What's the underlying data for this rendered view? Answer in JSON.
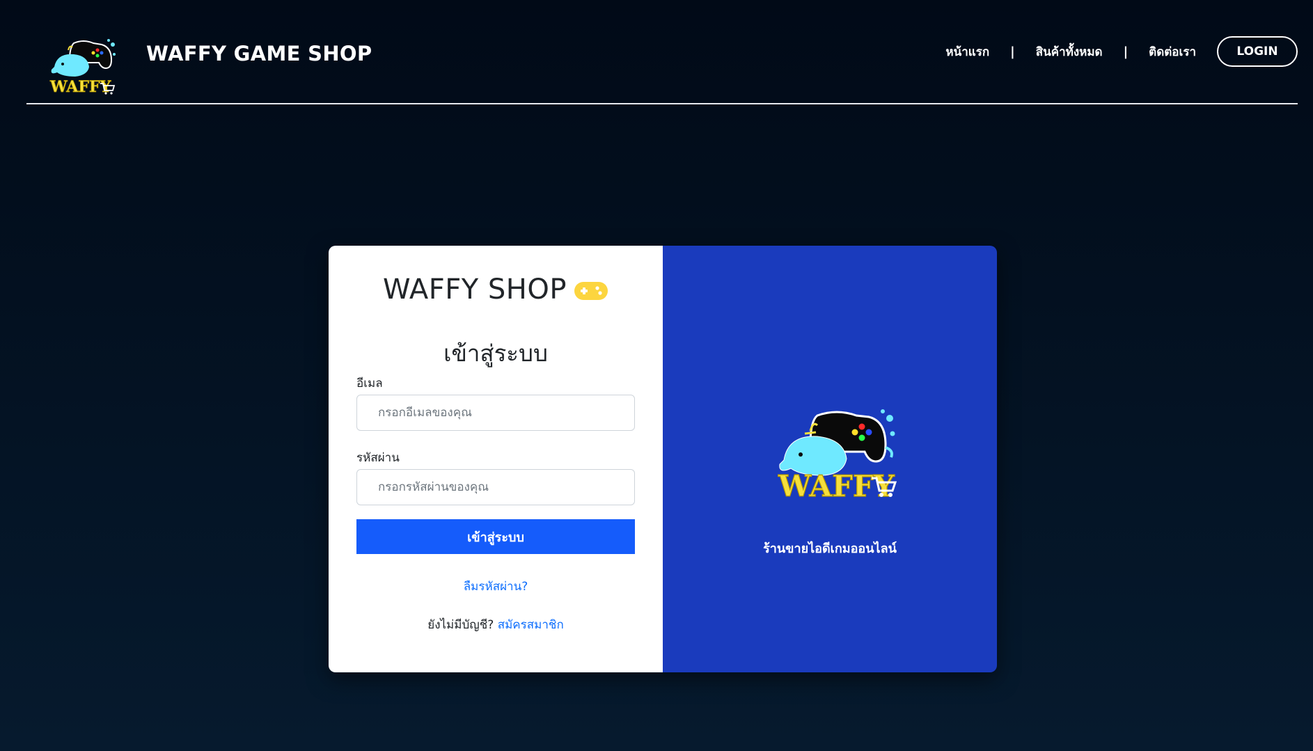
{
  "header": {
    "brand": "WAFFY GAME SHOP",
    "nav": {
      "home": "หน้าแรก",
      "products": "สินค้าทั้งหมด",
      "contact": "ติดต่อเรา",
      "separator": "|"
    },
    "login_button": "LOGIN"
  },
  "card": {
    "shop_title": "WAFFY SHOP",
    "heading": "เข้าสู่ระบบ",
    "email": {
      "label": "อีเมล",
      "placeholder": "กรอกอีเมลของคุณ",
      "value": ""
    },
    "password": {
      "label": "รหัสผ่าน",
      "placeholder": "กรอกรหัสผ่านของคุณ",
      "value": ""
    },
    "submit_label": "เข้าสู่ระบบ",
    "forgot_label": "ลืมรหัสผ่าน?",
    "no_account_text": "ยังไม่มีบัญชี?",
    "signup_label": "สมัครสมาชิก",
    "tagline": "ร้านขายไอดีเกมออนไลน์"
  },
  "logo_text": "WAFFY",
  "colors": {
    "background": "#010a17",
    "card_right": "#1a3bbd",
    "primary_button": "#155cfb",
    "link": "#0d6efd",
    "logo_yellow": "#f7e03c",
    "whale_cyan": "#6fe9ff"
  },
  "icons": {
    "gamepad": "gamepad-icon",
    "cart": "cart-icon"
  }
}
